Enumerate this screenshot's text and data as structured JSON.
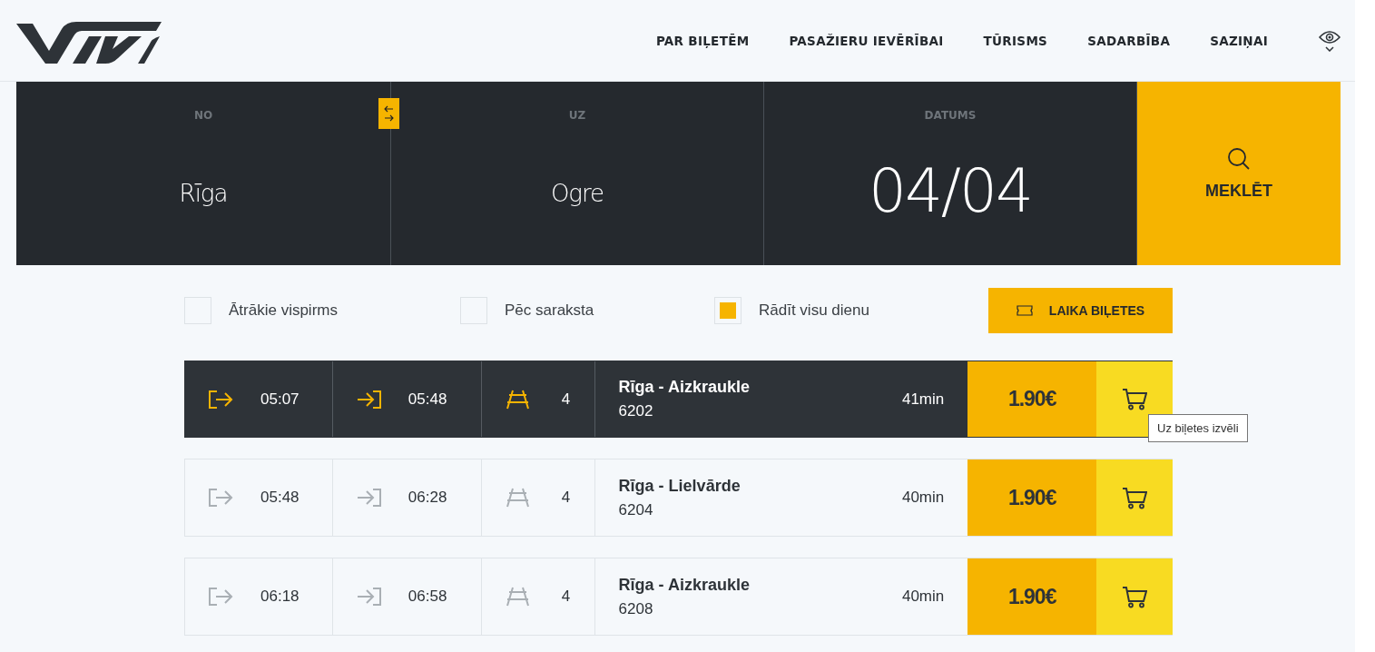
{
  "nav": {
    "items": [
      "PAR BIĻETĒM",
      "PASAŽIERU IEVĒRĪBAI",
      "TŪRISMS",
      "SADARBĪBA",
      "SAZIŅAI"
    ]
  },
  "search": {
    "fields": [
      {
        "label": "NO",
        "value": "Rīga"
      },
      {
        "label": "UZ",
        "value": "Ogre"
      },
      {
        "label": "DATUMS",
        "value": "04/04"
      }
    ],
    "button": "MEKLĒT"
  },
  "filters": [
    {
      "label": "Ātrākie vispirms",
      "checked": false
    },
    {
      "label": "Pēc saraksta",
      "checked": false
    },
    {
      "label": "Rādīt visu dienu",
      "checked": true
    }
  ],
  "ticket_button": "LAIKA BIĻETES",
  "trains": [
    {
      "selected": true,
      "departure": "05:07",
      "arrival": "05:48",
      "platform": "4",
      "route": "Rīga - Aizkraukle",
      "number": "6202",
      "duration": "41min",
      "price": "1.90€"
    },
    {
      "selected": false,
      "departure": "05:48",
      "arrival": "06:28",
      "platform": "4",
      "route": "Rīga - Lielvārde",
      "number": "6204",
      "duration": "40min",
      "price": "1.90€"
    },
    {
      "selected": false,
      "departure": "06:18",
      "arrival": "06:58",
      "platform": "4",
      "route": "Rīga - Aizkraukle",
      "number": "6208",
      "duration": "40min",
      "price": "1.90€"
    }
  ],
  "tooltip": "Uz biļetes izvēli"
}
